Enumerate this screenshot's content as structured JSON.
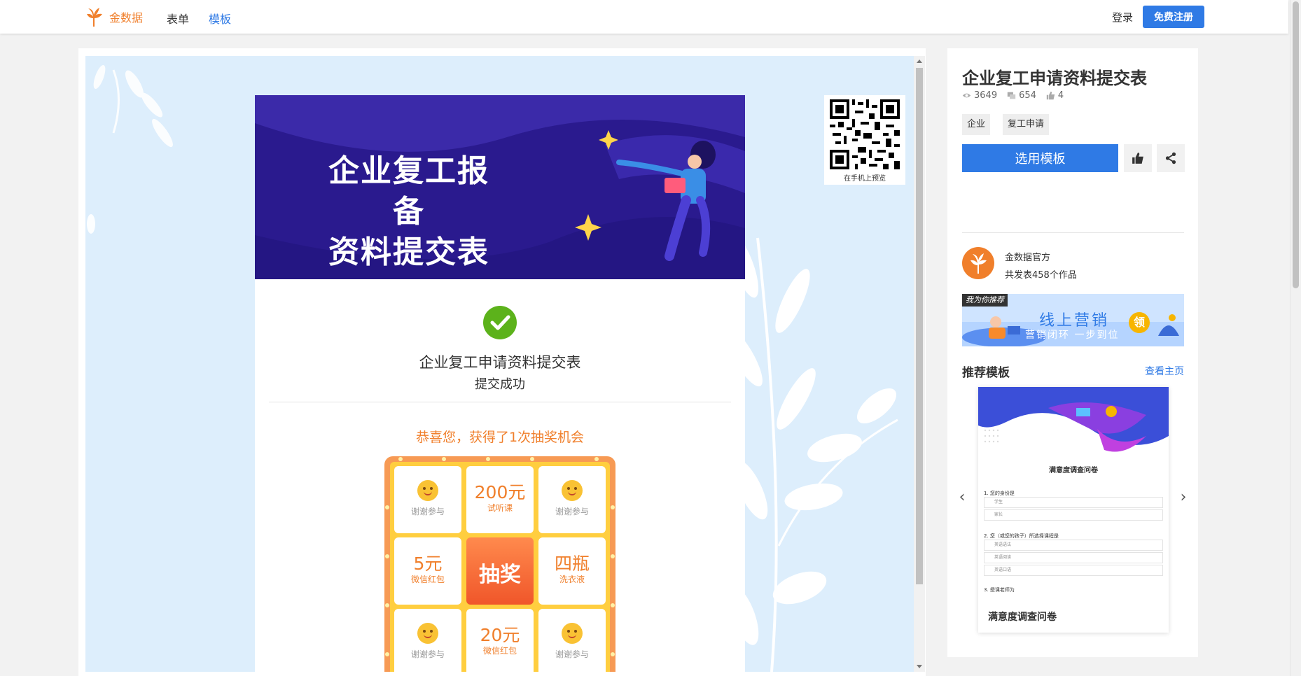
{
  "nav": {
    "brand": "金数据",
    "links": [
      "表单",
      "模板"
    ],
    "login": "登录",
    "register": "免费注册"
  },
  "preview": {
    "banner_title_line1": "企业复工报备",
    "banner_title_line2": "资料提交表",
    "form_name": "企业复工申请资料提交表",
    "submit_status": "提交成功",
    "lottery_title": "恭喜您，获得了1次抽奖机会",
    "prizes": [
      {
        "type": "thanks",
        "label": "谢谢参与"
      },
      {
        "type": "prize",
        "big": "200元",
        "small": "试听课"
      },
      {
        "type": "thanks",
        "label": "谢谢参与"
      },
      {
        "type": "prize",
        "big": "5元",
        "small": "微信红包"
      },
      {
        "type": "draw",
        "label": "抽奖"
      },
      {
        "type": "prize",
        "big": "四瓶",
        "small": "洗衣液"
      },
      {
        "type": "thanks",
        "label": "谢谢参与"
      },
      {
        "type": "prize",
        "big": "20元",
        "small": "微信红包"
      },
      {
        "type": "thanks",
        "label": "谢谢参与"
      }
    ],
    "qr_caption": "在手机上预览"
  },
  "template": {
    "title": "企业复工申请资料提交表",
    "views": "3649",
    "uses": "654",
    "likes": "4",
    "tags": [
      "企业",
      "复工申请"
    ],
    "use_button": "选用模板"
  },
  "author": {
    "name": "金数据官方",
    "works": "共发表458个作品"
  },
  "ad": {
    "tag": "我为你推荐",
    "title": "线上营销",
    "subtitle": "营销闭环 一步到位",
    "coin": "领"
  },
  "recommend": {
    "label": "推荐模板",
    "more": "查看主页",
    "card": {
      "thumb_title": "满意度调查问卷",
      "q1": "1. 您的身份是",
      "q1_opts": [
        "学生",
        "家长"
      ],
      "q2": "2. 您（或您的孩子）所选择课程是",
      "q2_opts": [
        "英语语法",
        "英语阅读",
        "英语口语"
      ],
      "q3": "3. 授课老师为",
      "name": "满意度调查问卷"
    }
  },
  "colors": {
    "brand_orange": "#f07f2b",
    "accent_blue": "#2f7ae5",
    "success_green": "#5cb21b",
    "banner_purple": "#2a1a8e"
  }
}
